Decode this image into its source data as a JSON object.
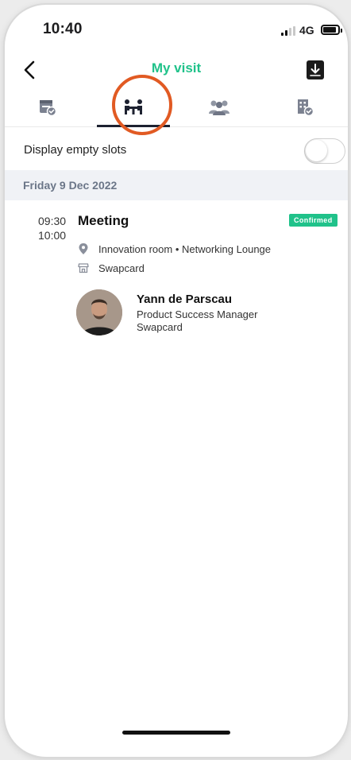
{
  "status_bar": {
    "time": "10:40",
    "network": "4G"
  },
  "header": {
    "title": "My visit"
  },
  "tabs": [
    {
      "icon": "calendar-check-icon",
      "active": false
    },
    {
      "icon": "meeting-people-icon",
      "active": true
    },
    {
      "icon": "group-people-icon",
      "active": false
    },
    {
      "icon": "building-check-icon",
      "active": false
    }
  ],
  "toggle": {
    "label": "Display empty slots",
    "on": false
  },
  "date_label": "Friday 9 Dec 2022",
  "meeting": {
    "start": "09:30",
    "end": "10:00",
    "title": "Meeting",
    "status": "Confirmed",
    "location": "Innovation room • Networking Lounge",
    "organization": "Swapcard",
    "person": {
      "name": "Yann de Parscau",
      "role": "Product Success Manager",
      "company": "Swapcard"
    }
  },
  "colors": {
    "accent": "#20c28a",
    "annotation": "#e15a23",
    "tab_indicator": "#1d2130",
    "date_band": "#f0f2f6"
  }
}
